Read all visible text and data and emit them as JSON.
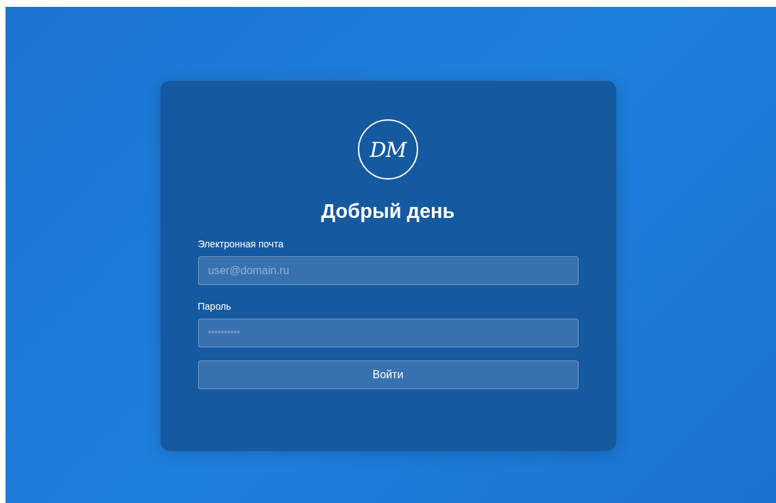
{
  "logo": {
    "text": "DM"
  },
  "title": "Добрый день",
  "fields": [
    {
      "label": "Электронная почта",
      "placeholder": "user@domain.ru",
      "kind": "text"
    },
    {
      "label": "Пароль",
      "placeholder": "**********",
      "kind": "secret"
    }
  ],
  "button": {
    "label": "Войти"
  }
}
